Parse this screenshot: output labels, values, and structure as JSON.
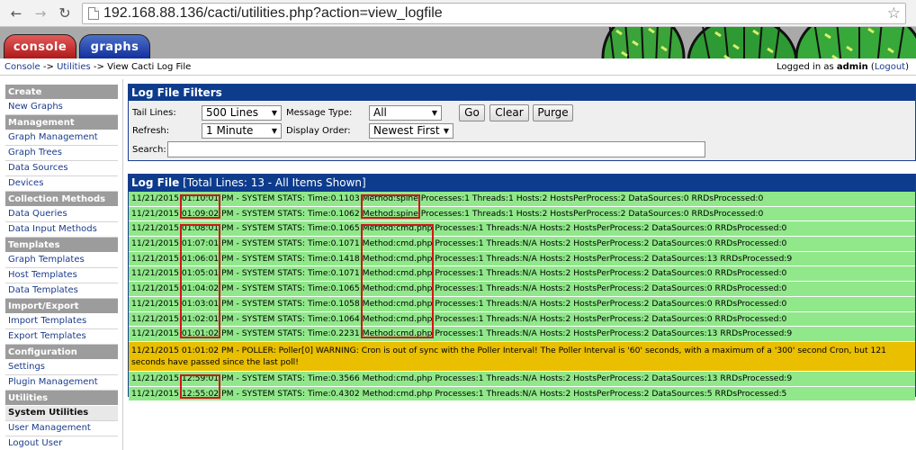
{
  "browser": {
    "back_icon": "arrow-left-icon",
    "forward_icon": "arrow-right-icon",
    "reload_icon": "reload-icon",
    "url": "192.168.88.136/cacti/utilities.php?action=view_logfile",
    "star_icon": "star-icon"
  },
  "tabs": {
    "console": "console",
    "graphs": "graphs"
  },
  "breadcrumb": {
    "console": "Console",
    "sep": "->",
    "utilities": "Utilities",
    "current": "View Cacti Log File"
  },
  "login": {
    "prefix": "Logged in as",
    "user": "admin",
    "logout": "Logout"
  },
  "sidebar": {
    "sections": [
      {
        "head": "Create",
        "items": [
          "New Graphs"
        ]
      },
      {
        "head": "Management",
        "items": [
          "Graph Management",
          "Graph Trees",
          "Data Sources",
          "Devices"
        ]
      },
      {
        "head": "Collection Methods",
        "items": [
          "Data Queries",
          "Data Input Methods"
        ]
      },
      {
        "head": "Templates",
        "items": [
          "Graph Templates",
          "Host Templates",
          "Data Templates"
        ]
      },
      {
        "head": "Import/Export",
        "items": [
          "Import Templates",
          "Export Templates"
        ]
      },
      {
        "head": "Configuration",
        "items": [
          "Settings",
          "Plugin Management"
        ]
      },
      {
        "head": "Utilities",
        "items": [
          "System Utilities",
          "User Management",
          "Logout User"
        ]
      }
    ]
  },
  "filters": {
    "title": "Log File Filters",
    "tail_label": "Tail Lines:",
    "tail_value": "500 Lines",
    "type_label": "Message Type:",
    "type_value": "All",
    "refresh_label": "Refresh:",
    "refresh_value": "1 Minute",
    "order_label": "Display Order:",
    "order_value": "Newest First",
    "search_label": "Search:",
    "search_value": "",
    "go": "Go",
    "clear": "Clear",
    "purge": "Purge"
  },
  "log": {
    "title": "Log File",
    "summary": "[Total Lines: 13 - All Items Shown]",
    "colors": {
      "ok": "#90e88a",
      "warning": "#e9bf00",
      "highlight": "#d2161a"
    },
    "rows": [
      {
        "date": "11/21/2015",
        "time": "01:10:01",
        "text": "PM - SYSTEM STATS: Time:0.1103",
        "method": "Method:spine",
        "rest": "Processes:1 Threads:1 Hosts:2 HostsPerProcess:2 DataSources:0 RRDsProcessed:0"
      },
      {
        "date": "11/21/2015",
        "time": "01:09:02",
        "text": "PM - SYSTEM STATS: Time:0.1062",
        "method": "Method:spine",
        "rest": "Processes:1 Threads:1 Hosts:2 HostsPerProcess:2 DataSources:0 RRDsProcessed:0"
      },
      {
        "date": "11/21/2015",
        "time": "01:08:01",
        "text": "PM - SYSTEM STATS: Time:0.1065",
        "method": "Method:cmd.php",
        "rest": "Processes:1 Threads:N/A Hosts:2 HostsPerProcess:2 DataSources:0 RRDsProcessed:0"
      },
      {
        "date": "11/21/2015",
        "time": "01:07:01",
        "text": "PM - SYSTEM STATS: Time:0.1071",
        "method": "Method:cmd.php",
        "rest": "Processes:1 Threads:N/A Hosts:2 HostsPerProcess:2 DataSources:0 RRDsProcessed:0"
      },
      {
        "date": "11/21/2015",
        "time": "01:06:01",
        "text": "PM - SYSTEM STATS: Time:0.1418",
        "method": "Method:cmd.php",
        "rest": "Processes:1 Threads:N/A Hosts:2 HostsPerProcess:2 DataSources:13 RRDsProcessed:9"
      },
      {
        "date": "11/21/2015",
        "time": "01:05:01",
        "text": "PM - SYSTEM STATS: Time:0.1071",
        "method": "Method:cmd.php",
        "rest": "Processes:1 Threads:N/A Hosts:2 HostsPerProcess:2 DataSources:0 RRDsProcessed:0"
      },
      {
        "date": "11/21/2015",
        "time": "01:04:02",
        "text": "PM - SYSTEM STATS: Time:0.1065",
        "method": "Method:cmd.php",
        "rest": "Processes:1 Threads:N/A Hosts:2 HostsPerProcess:2 DataSources:0 RRDsProcessed:0"
      },
      {
        "date": "11/21/2015",
        "time": "01:03:01",
        "text": "PM - SYSTEM STATS: Time:0.1058",
        "method": "Method:cmd.php",
        "rest": "Processes:1 Threads:N/A Hosts:2 HostsPerProcess:2 DataSources:0 RRDsProcessed:0"
      },
      {
        "date": "11/21/2015",
        "time": "01:02:01",
        "text": "PM - SYSTEM STATS: Time:0.1064",
        "method": "Method:cmd.php",
        "rest": "Processes:1 Threads:N/A Hosts:2 HostsPerProcess:2 DataSources:0 RRDsProcessed:0"
      },
      {
        "date": "11/21/2015",
        "time": "01:01:02",
        "text": "PM - SYSTEM STATS: Time:0.2231",
        "method": "Method:cmd.php",
        "rest": "Processes:1 Threads:N/A Hosts:2 HostsPerProcess:2 DataSources:13 RRDsProcessed:9"
      },
      {
        "warning": "11/21/2015 01:01:02 PM - POLLER: Poller[0] WARNING: Cron is out of sync with the Poller Interval! The Poller Interval is '60' seconds, with a maximum of a '300' second Cron, but 121 seconds have passed since the last poll!"
      },
      {
        "date": "11/21/2015",
        "time": "12:59:01",
        "text": "PM - SYSTEM STATS: Time:0.3566",
        "method": "Method:cmd.php",
        "rest": "Processes:1 Threads:N/A Hosts:2 HostsPerProcess:2 DataSources:13 RRDsProcessed:9"
      },
      {
        "date": "11/21/2015",
        "time": "12:55:02",
        "text": "PM - SYSTEM STATS: Time:0.4302",
        "method": "Method:cmd.php",
        "rest": "Processes:1 Threads:N/A Hosts:2 HostsPerProcess:2 DataSources:5 RRDsProcessed:5"
      }
    ]
  }
}
